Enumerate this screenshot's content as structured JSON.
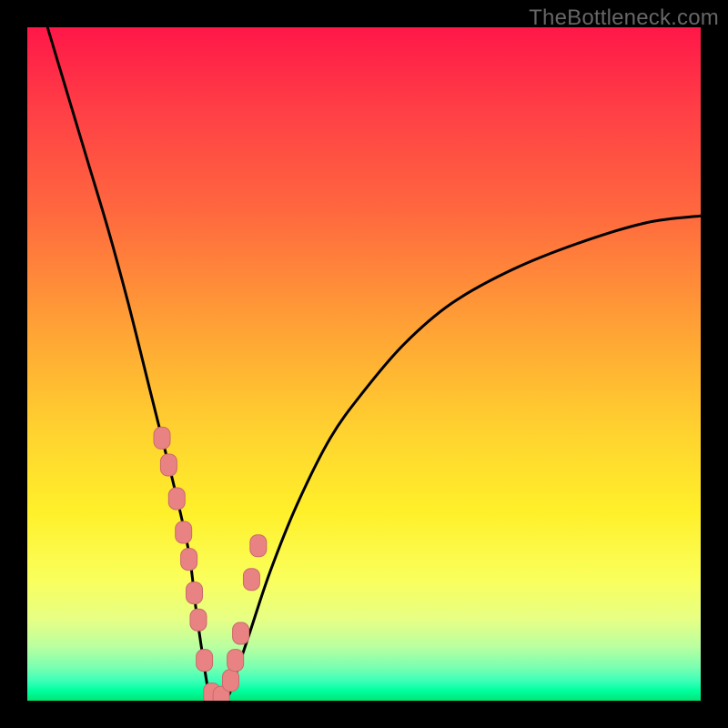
{
  "watermark": "TheBottleneck.com",
  "colors": {
    "frame": "#000000",
    "curve": "#000000",
    "marker_fill": "#e98383",
    "marker_stroke": "#c96a6a"
  },
  "chart_data": {
    "type": "line",
    "title": "",
    "xlabel": "",
    "ylabel": "",
    "xlim": [
      0,
      100
    ],
    "ylim": [
      0,
      100
    ],
    "note": "No axis ticks or numeric labels are visible in the image; x/y values are estimated from pixel position on a 0–100 normalized scale. Curve is a V-shaped response dipping to ~0 near x≈27 and rising asymptotically toward ~72 on the right.",
    "series": [
      {
        "name": "curve",
        "x": [
          3,
          6,
          9,
          12,
          15,
          18,
          20,
          22,
          24,
          25,
          26,
          27,
          28,
          29,
          30,
          31,
          33,
          36,
          40,
          45,
          50,
          56,
          63,
          72,
          82,
          92,
          100
        ],
        "y": [
          100,
          90,
          80,
          70,
          59,
          47,
          39,
          31,
          22,
          14,
          7,
          1,
          0,
          0,
          1,
          4,
          10,
          19,
          29,
          39,
          46,
          53,
          59,
          64,
          68,
          71,
          72
        ]
      }
    ],
    "markers": {
      "name": "highlighted-points",
      "shape": "rounded-rect",
      "x": [
        20,
        21,
        22.2,
        23.2,
        24,
        24.8,
        25.4,
        26.3,
        27.4,
        28.8,
        30.2,
        30.9,
        31.7,
        33.3,
        34.3
      ],
      "y": [
        39,
        35,
        30,
        25,
        21,
        16,
        12,
        6,
        1,
        0.5,
        3,
        6,
        10,
        18,
        23
      ]
    }
  }
}
